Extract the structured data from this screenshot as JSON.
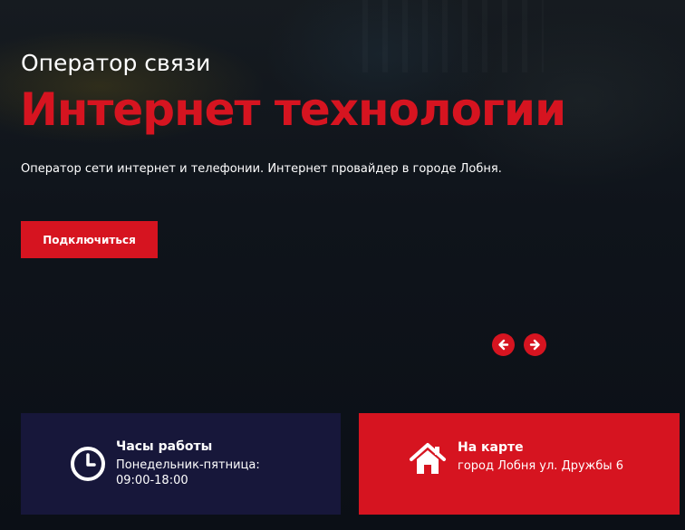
{
  "hero": {
    "subtitle": "Оператор связи",
    "title": "Интернет технологии",
    "description": "Оператор сети интернет и телефонии. Интернет провайдер в городе Лобня.",
    "cta_label": "Подключиться"
  },
  "slider": {
    "prev_icon": "arrow-left-icon",
    "next_icon": "arrow-right-icon"
  },
  "info_cards": {
    "hours": {
      "icon": "clock-icon",
      "title": "Часы работы",
      "line1": "Понедельник-пятница:",
      "line2": "09:00-18:00"
    },
    "map": {
      "icon": "home-icon",
      "title": "На карте",
      "address": "город Лобня ул. Дружбы 6"
    }
  },
  "colors": {
    "accent": "#d61420",
    "hours_card_bg": "#17173a",
    "background": "#0d1118",
    "text": "#ffffff"
  }
}
